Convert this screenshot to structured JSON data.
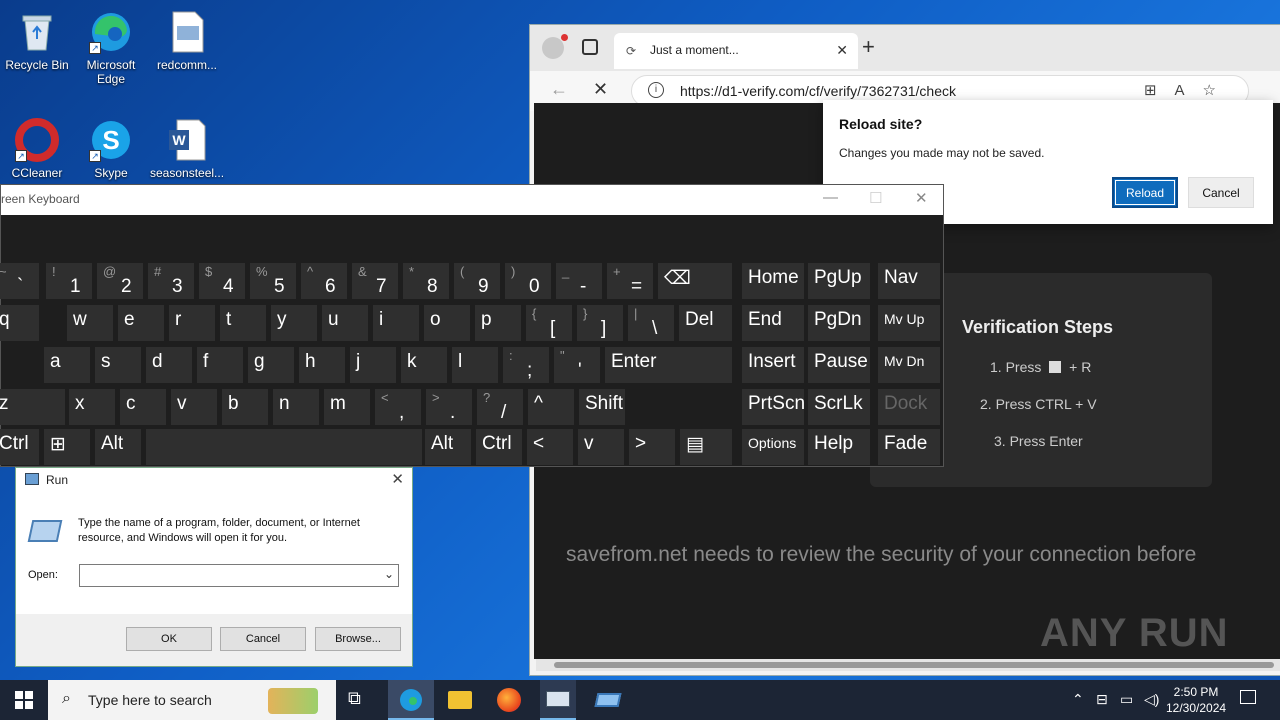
{
  "desktop": {
    "icons": [
      {
        "label": "Recycle Bin"
      },
      {
        "label": "Microsoft Edge"
      },
      {
        "label": "redcomm..."
      },
      {
        "label": "CCleaner"
      },
      {
        "label": "Skype"
      },
      {
        "label": "seasonsteel..."
      }
    ]
  },
  "browser": {
    "tab_title": "Just a moment...",
    "url": "https://d1-verify.com/cf/verify/7362731/check",
    "page_message": "savefrom.net needs to review the security of your connection before",
    "verification": {
      "title": "Verification Steps",
      "step1_prefix": "1. Press",
      "step1_suffix": "+ R",
      "step2": "2. Press CTRL + V",
      "step3": "3. Press Enter"
    },
    "watermark": "ANY RUN",
    "dialog": {
      "title": "Reload site?",
      "message": "Changes you made may not be saved.",
      "reload": "Reload",
      "cancel": "Cancel"
    }
  },
  "osk": {
    "title": "reen Keyboard",
    "keys": [
      {
        "sub": "~",
        "main": "`"
      },
      {
        "sub": "!",
        "main": "1"
      },
      {
        "sub": "@",
        "main": "2"
      },
      {
        "sub": "#",
        "main": "3"
      },
      {
        "sub": "$",
        "main": "4"
      },
      {
        "sub": "%",
        "main": "5"
      },
      {
        "sub": "^",
        "main": "6"
      },
      {
        "sub": "&",
        "main": "7"
      },
      {
        "sub": "*",
        "main": "8"
      },
      {
        "sub": "(",
        "main": "9"
      },
      {
        "sub": ")",
        "main": "0"
      },
      {
        "sub": "_",
        "main": "-"
      },
      {
        "sub": "+",
        "main": "="
      },
      {
        "sub": "",
        "main": "⌫"
      },
      {
        "sub": "",
        "main": "q"
      },
      {
        "sub": "",
        "main": "w"
      },
      {
        "sub": "",
        "main": "e"
      },
      {
        "sub": "",
        "main": "r"
      },
      {
        "sub": "",
        "main": "t"
      },
      {
        "sub": "",
        "main": "y"
      },
      {
        "sub": "",
        "main": "u"
      },
      {
        "sub": "",
        "main": "i"
      },
      {
        "sub": "",
        "main": "o"
      },
      {
        "sub": "",
        "main": "p"
      },
      {
        "sub": "{",
        "main": "["
      },
      {
        "sub": "}",
        "main": "]"
      },
      {
        "sub": "|",
        "main": "\\"
      },
      {
        "sub": "",
        "main": "Del"
      },
      {
        "sub": "",
        "main": "a"
      },
      {
        "sub": "",
        "main": "s"
      },
      {
        "sub": "",
        "main": "d"
      },
      {
        "sub": "",
        "main": "f"
      },
      {
        "sub": "",
        "main": "g"
      },
      {
        "sub": "",
        "main": "h"
      },
      {
        "sub": "",
        "main": "j"
      },
      {
        "sub": "",
        "main": "k"
      },
      {
        "sub": "",
        "main": "l"
      },
      {
        "sub": ":",
        "main": ";"
      },
      {
        "sub": "\"",
        "main": "'"
      },
      {
        "sub": "",
        "main": "Enter"
      },
      {
        "sub": "",
        "main": "z"
      },
      {
        "sub": "",
        "main": "x"
      },
      {
        "sub": "",
        "main": "c"
      },
      {
        "sub": "",
        "main": "v"
      },
      {
        "sub": "",
        "main": "b"
      },
      {
        "sub": "",
        "main": "n"
      },
      {
        "sub": "",
        "main": "m"
      },
      {
        "sub": "<",
        "main": ","
      },
      {
        "sub": ">",
        "main": "."
      },
      {
        "sub": "?",
        "main": "/"
      },
      {
        "sub": "",
        "main": "^"
      },
      {
        "sub": "",
        "main": "Shift"
      },
      {
        "sub": "",
        "main": "Ctrl"
      },
      {
        "sub": "",
        "main": "⊞"
      },
      {
        "sub": "",
        "main": "Alt"
      },
      {
        "sub": "",
        "main": ""
      },
      {
        "sub": "",
        "main": "Alt"
      },
      {
        "sub": "",
        "main": "Ctrl"
      },
      {
        "sub": "",
        "main": "<"
      },
      {
        "sub": "",
        "main": "v"
      },
      {
        "sub": "",
        "main": ">"
      },
      {
        "sub": "",
        "main": "▤"
      },
      {
        "sub": "",
        "main": "Home"
      },
      {
        "sub": "",
        "main": "PgUp"
      },
      {
        "sub": "",
        "main": "Nav"
      },
      {
        "sub": "",
        "main": "End"
      },
      {
        "sub": "",
        "main": "PgDn"
      },
      {
        "sub": "",
        "main": "Mv Up"
      },
      {
        "sub": "",
        "main": "Insert"
      },
      {
        "sub": "",
        "main": "Pause"
      },
      {
        "sub": "",
        "main": "Mv Dn"
      },
      {
        "sub": "",
        "main": "PrtScn"
      },
      {
        "sub": "",
        "main": "ScrLk"
      },
      {
        "sub": "",
        "main": "Dock"
      },
      {
        "sub": "",
        "main": "Options"
      },
      {
        "sub": "",
        "main": "Help"
      },
      {
        "sub": "",
        "main": "Fade"
      }
    ]
  },
  "run": {
    "title": "Run",
    "description": "Type the name of a program, folder, document, or Internet resource, and Windows will open it for you.",
    "open_label": "Open:",
    "open_value": "",
    "ok": "OK",
    "cancel": "Cancel",
    "browse": "Browse..."
  },
  "taskbar": {
    "search_placeholder": "Type here to search",
    "time": "2:50 PM",
    "date": "12/30/2024"
  },
  "colors": {
    "accent": "#0f6cbd",
    "osk_key": "#2f2f2f",
    "taskbar": "#1c2535"
  }
}
